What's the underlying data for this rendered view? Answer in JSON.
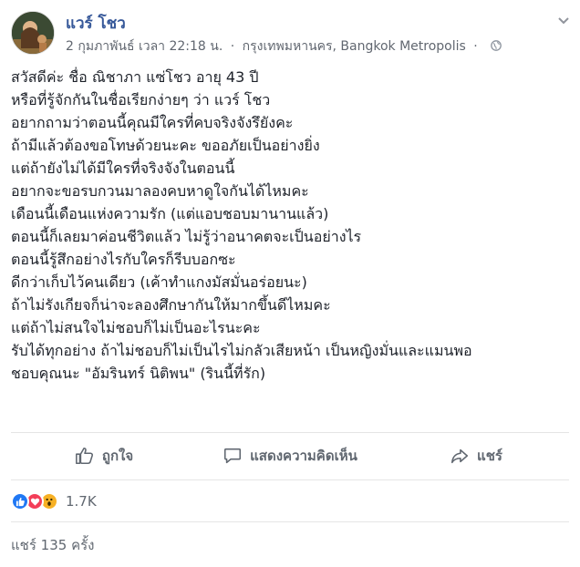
{
  "post": {
    "author": "แวร์ โชว",
    "date": "2 กุมภาพันธ์ เวลา 22:18 น.",
    "location": "กรุงเทพมหานคร, Bangkok Metropolis",
    "separator": "·",
    "lines": [
      "สวัสดีค่ะ ชื่อ ณิชาภา แซ่โชว อายุ 43 ปี",
      "หรือที่รู้จักกันในชื่อเรียกง่ายๆ ว่า แวร์ โชว",
      "อยากถามว่าตอนนี้คุณมีใครที่คบจริงจังรึยังคะ",
      "ถ้ามีแล้วต้องขอโทษด้วยนะคะ ขออภัยเป็นอย่างยิ่ง",
      "แต่ถ้ายังไม่ได้มีใครที่จริงจังในตอนนี้",
      "อยากจะขอรบกวนมาลองคบหาดูใจกันได้ไหมคะ",
      "เดือนนี้เดือนแห่งความรัก (แต่แอบชอบมานานแล้ว)",
      "ตอนนี้ก็เลยมาค่อนชีวิตแล้ว ไม่รู้ว่าอนาคตจะเป็นอย่างไร",
      "ตอนนี้รู้สึกอย่างไรกับใครก็รีบบอกซะ",
      "ดีกว่าเก็บไว้คนเดียว (เค้าทำแกงมัสมั่นอร่อยนะ)",
      "ถ้าไม่รังเกียจก็น่าจะลองศึกษากันให้มากขึ้นดีไหมคะ",
      "แต่ถ้าไม่สนใจไม่ชอบก็ไม่เป็นอะไรนะคะ",
      "รับได้ทุกอย่าง ถ้าไม่ชอบก็ไม่เป็นไรไม่กลัวเสียหน้า เป็นหญิงมั่นและแมนพอ",
      "ชอบคุณนะ \"อัมรินทร์ นิติพน\" (รินนี้ที่รัก)"
    ]
  },
  "actions": {
    "like": "ถูกใจ",
    "comment": "แสดงความคิดเห็น",
    "share": "แชร์"
  },
  "reactions": {
    "types": [
      "like",
      "love",
      "wow"
    ],
    "count": "1.7K"
  },
  "shares": "แชร์ 135 ครั้ง",
  "colors": {
    "author": "#365899",
    "meta": "#616770",
    "like": "#2078f4",
    "love": "#f33e58",
    "wow": "#f7b125"
  }
}
